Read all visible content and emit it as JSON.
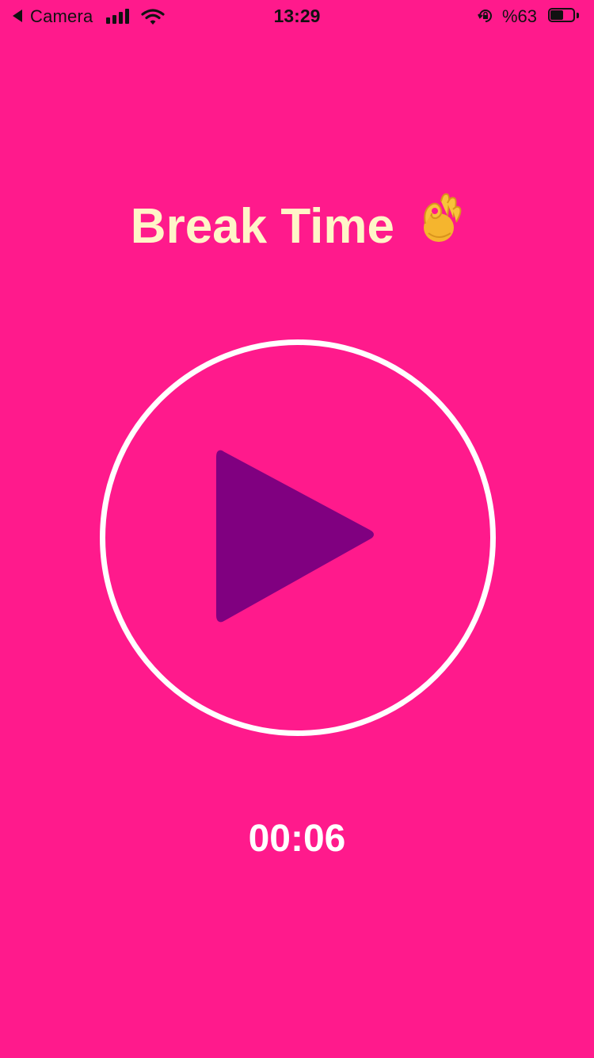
{
  "status_bar": {
    "back_label": "Camera",
    "time": "13:29",
    "battery_percent_text": "%63",
    "battery_level": 0.63,
    "signal_bars": 4,
    "wifi_icon": "wifi-icon",
    "rotation_lock_icon": "rotation-lock-icon"
  },
  "screen": {
    "title": "Break Time",
    "title_emoji": "ok-hand-emoji",
    "play_button_icon": "play-icon",
    "timer": "00:06"
  },
  "colors": {
    "background": "#FF1A8C",
    "title": "#FFF5C8",
    "ring": "#FFFFFF",
    "play_icon": "#800080",
    "timer": "#FFFFFF"
  }
}
